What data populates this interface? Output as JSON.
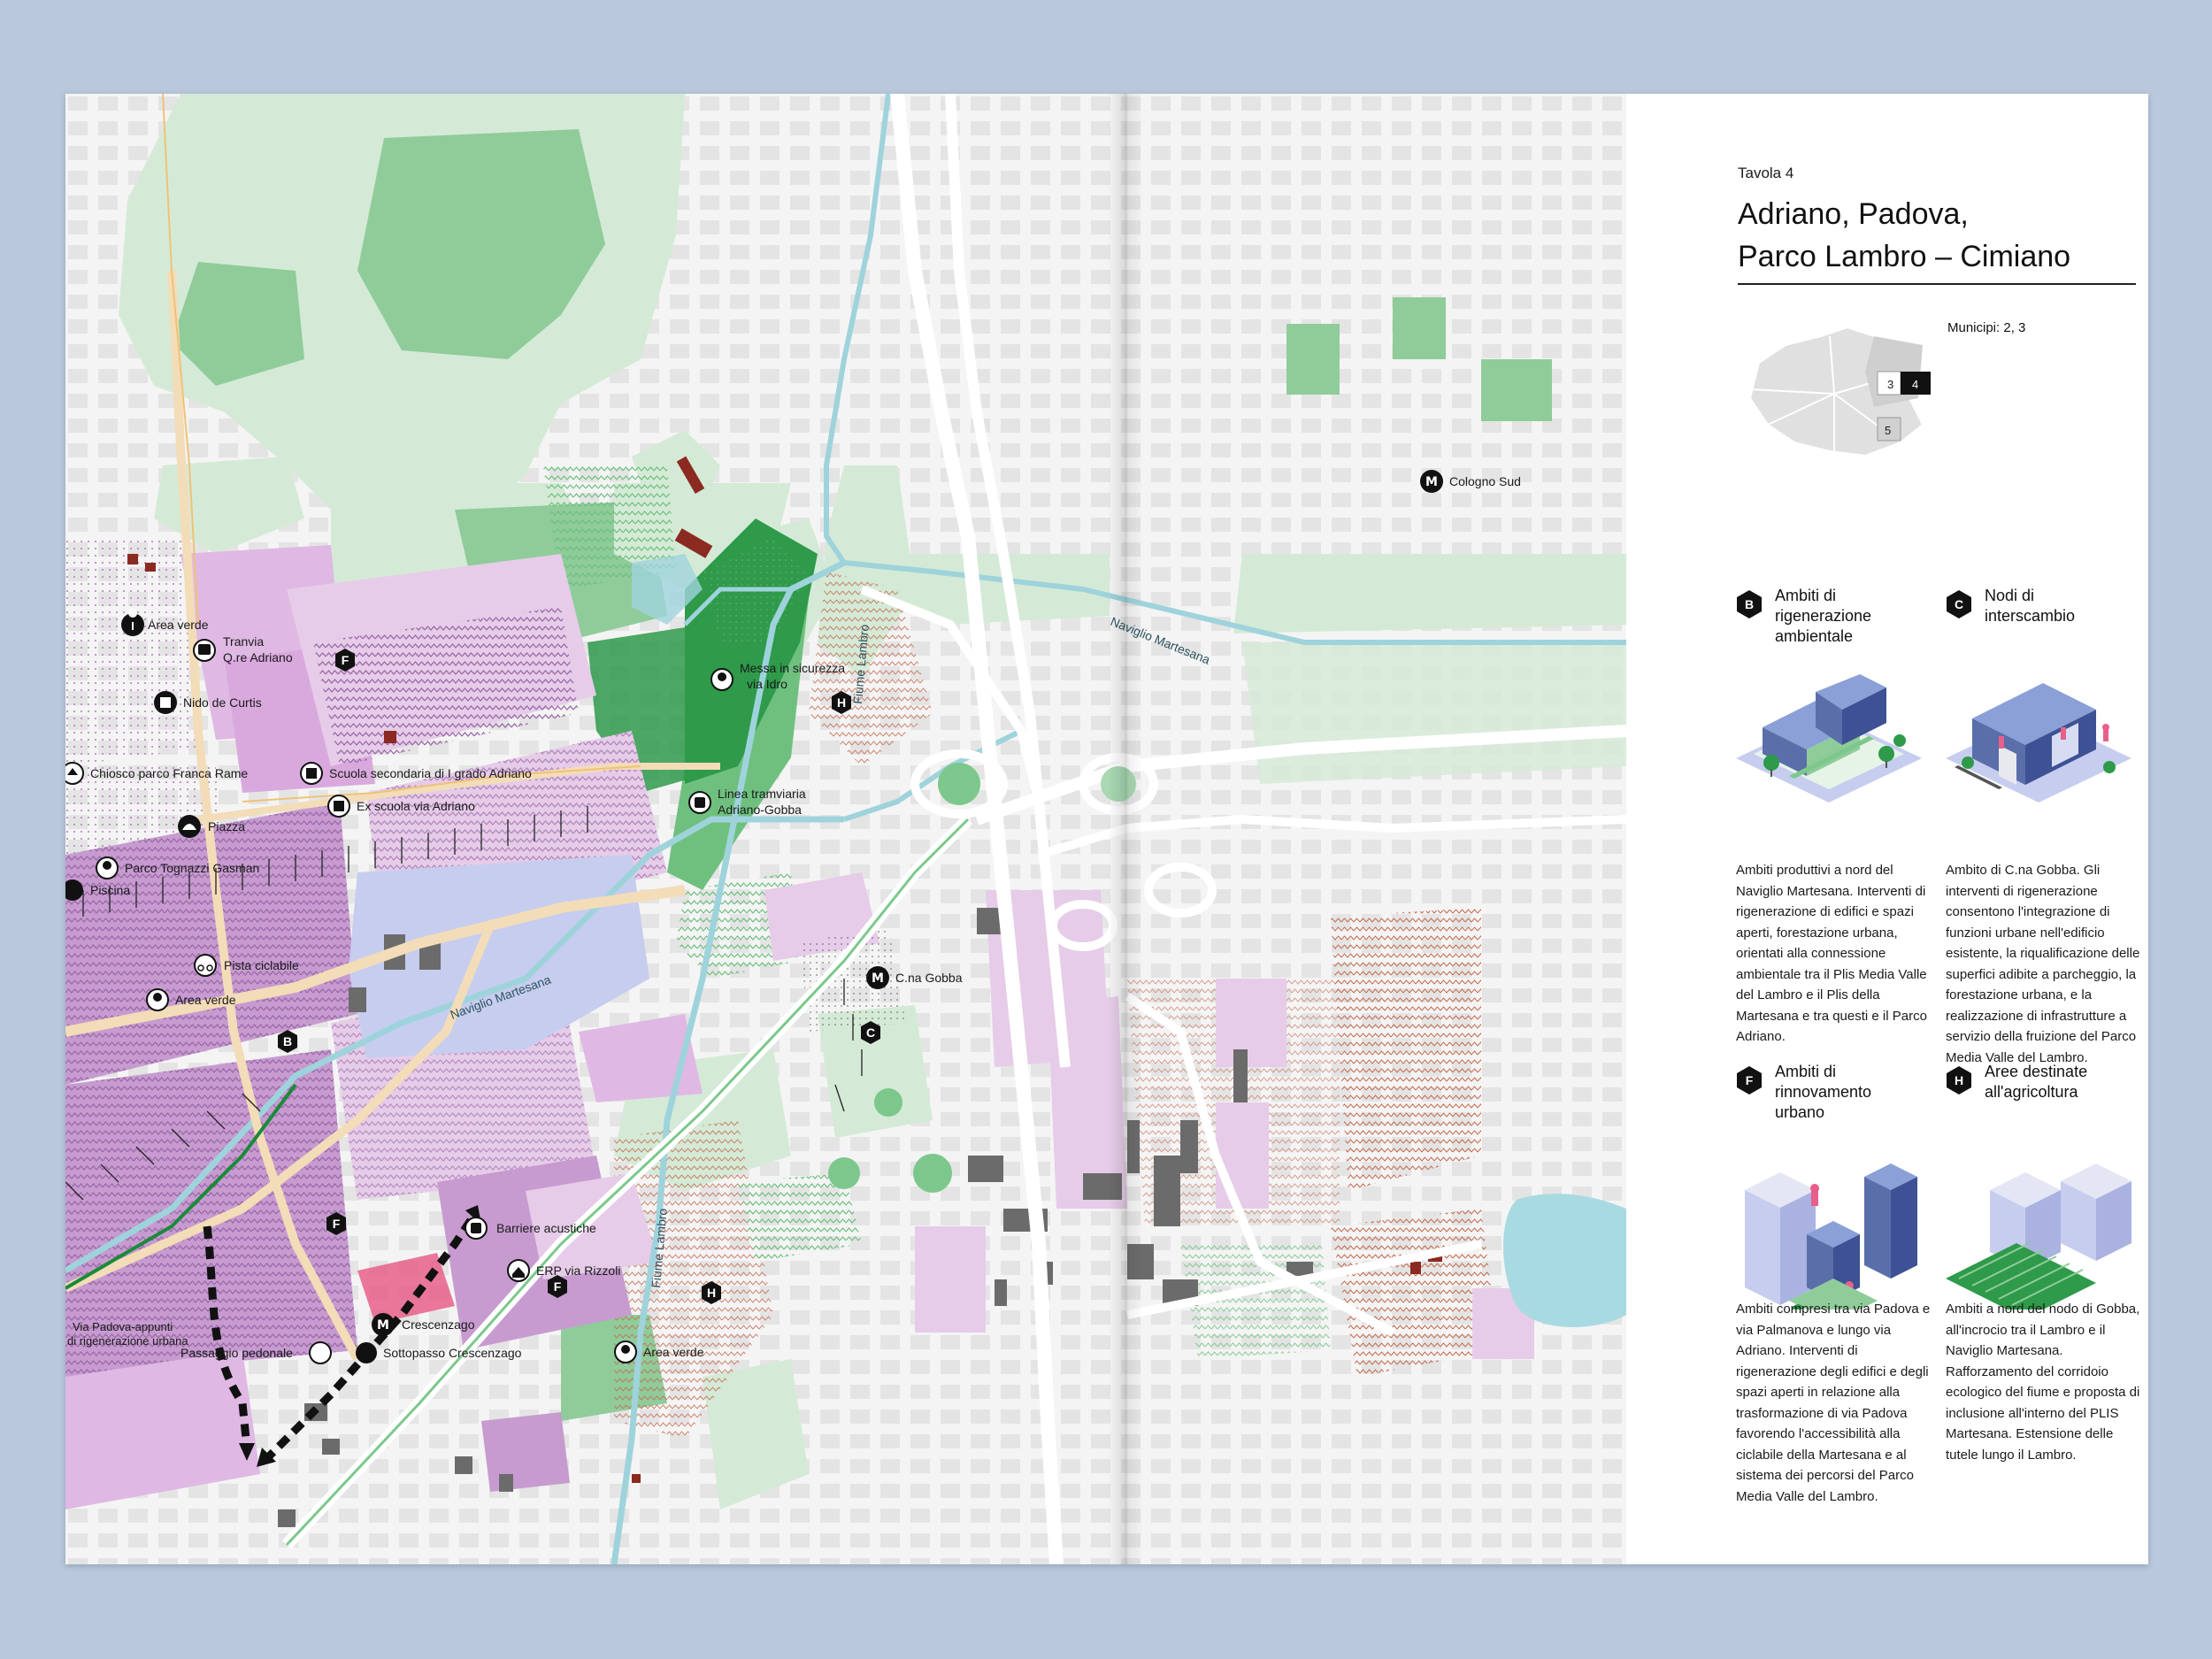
{
  "page": {
    "board_label": "Tavola 4",
    "title_lines": [
      "Adriano, Padova,",
      "Parco Lambro – Cimiano"
    ],
    "municipi_label": "Municipi: 2, 3",
    "minimap_numbers": [
      "3",
      "4",
      "5"
    ]
  },
  "map": {
    "metro_stations": [
      {
        "symbol": "M",
        "label": "Cologno Sud"
      },
      {
        "symbol": "M",
        "label": "C.na Gobba"
      },
      {
        "symbol": "M",
        "label": "Crescenzago"
      }
    ],
    "area_markers": [
      "B",
      "F",
      "F",
      "F",
      "C",
      "H",
      "H"
    ],
    "pois": {
      "area_verde_1": "Area verde",
      "tranvia_1": "Tranvia",
      "tranvia_2": "Q.re Adriano",
      "nido": "Nido de Curtis",
      "chiosco": "Chiosco parco Franca Rame",
      "scuola": "Scuola secondaria di I grado Adriano",
      "ex_scuola": "Ex scuola via Adriano",
      "piazza": "Piazza",
      "parco_tognazzi": "Parco Tognazzi Gasman",
      "piscina": "Piscina",
      "pista": "Pista ciclabile",
      "area_verde_2": "Area verde",
      "messa_1": "Messa in sicurezza",
      "messa_2": "via Idro",
      "linea_1": "Linea tramviaria",
      "linea_2": "Adriano-Gobba",
      "barriere": "Barriere acustiche",
      "erp": "ERP via Rizzoli",
      "sottopasso": "Sottopasso Crescenzago",
      "passaggio": "Passaggio pedonale",
      "area_verde_3": "Area verde",
      "via_padova_1": "Via Padova-appunti",
      "via_padova_2": "di rigenerazione urbana"
    },
    "water": {
      "naviglio_1": "Naviglio Martesana",
      "naviglio_2": "Naviglio Martesana",
      "fiume_1": "Fiume Lambro",
      "fiume_2": "Fiume Lambro"
    },
    "colors": {
      "green_light": "#d4ead6",
      "green_mid": "#8fcc9a",
      "green_dark": "#2e9a4a",
      "purple_light": "#e6cce8",
      "purple_mid": "#c79bd0",
      "blue_area": "#c7cdef",
      "water": "#9fd3dc",
      "building": "#6b6b6b",
      "red_building": "#8b2a20",
      "road": "#f3dcb8"
    }
  },
  "categories": [
    {
      "marker": "B",
      "title_lines": [
        "Ambiti di",
        "rigenerazione",
        "ambientale"
      ],
      "text": "Ambiti produttivi a nord del Naviglio Martesana. Interventi di rigenerazione di edifici e spazi aperti, forestazione urbana, orientati alla connessione ambientale tra il Plis Media Valle del Lambro e il Plis della Martesana e tra questi e il Parco Adriano."
    },
    {
      "marker": "C",
      "title_lines": [
        "Nodi di",
        "interscambio"
      ],
      "text": "Ambito di C.na Gobba. Gli interventi di rigenerazione consentono l'integrazione di funzioni urbane nell'edificio esistente, la riqualificazione delle superfici adibite a parcheggio, la forestazione urbana, e la realizzazione di infrastrutture a servizio della fruizione del Parco Media Valle del Lambro."
    },
    {
      "marker": "F",
      "title_lines": [
        "Ambiti di",
        "rinnovamento",
        "urbano"
      ],
      "text": "Ambiti compresi tra via Padova e via Palmanova e lungo via Adriano. Interventi di rigenerazione degli edifici e degli spazi aperti in relazione alla trasformazione di via Padova favorendo l'accessibilità alla ciclabile della Martesana e al sistema dei percorsi del Parco Media Valle del Lambro."
    },
    {
      "marker": "H",
      "title_lines": [
        "Aree destinate",
        "all'agricoltura"
      ],
      "text": "Ambiti a nord del nodo di Gobba, all'incrocio tra il Lambro e il Naviglio Martesana. Rafforzamento del corridoio ecologico del fiume e proposta di inclusione all'interno del PLIS Martesana. Estensione delle tutele lungo il Lambro."
    }
  ]
}
